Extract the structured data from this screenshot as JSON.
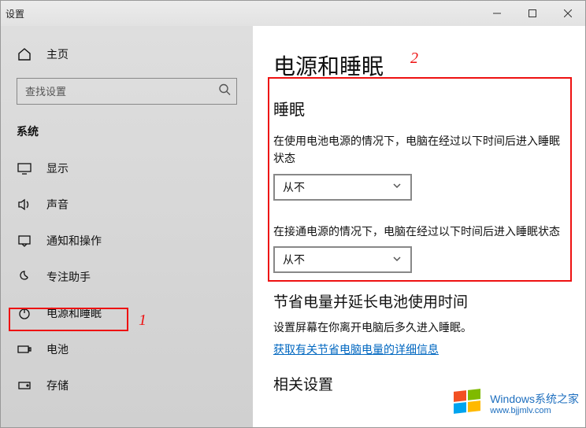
{
  "window": {
    "title": "设置"
  },
  "sidebar": {
    "home": "主页",
    "search_placeholder": "查找设置",
    "section": "系统",
    "items": [
      {
        "label": "显示"
      },
      {
        "label": "声音"
      },
      {
        "label": "通知和操作"
      },
      {
        "label": "专注助手"
      },
      {
        "label": "电源和睡眠"
      },
      {
        "label": "电池"
      },
      {
        "label": "存储"
      }
    ]
  },
  "page": {
    "title": "电源和睡眠",
    "sleep_heading": "睡眠",
    "battery_desc": "在使用电池电源的情况下，电脑在经过以下时间后进入睡眠状态",
    "battery_value": "从不",
    "plugged_desc": "在接通电源的情况下，电脑在经过以下时间后进入睡眠状态",
    "plugged_value": "从不",
    "save_heading": "节省电量并延长电池使用时间",
    "save_desc": "设置屏幕在你离开电脑后多久进入睡眠。",
    "save_link": "获取有关节省电脑电量的详细信息",
    "related_heading": "相关设置"
  },
  "annotations": {
    "n1": "1",
    "n2": "2"
  },
  "watermark": {
    "line1": "Windows系统之家",
    "line2": "www.bjjmlv.com"
  }
}
